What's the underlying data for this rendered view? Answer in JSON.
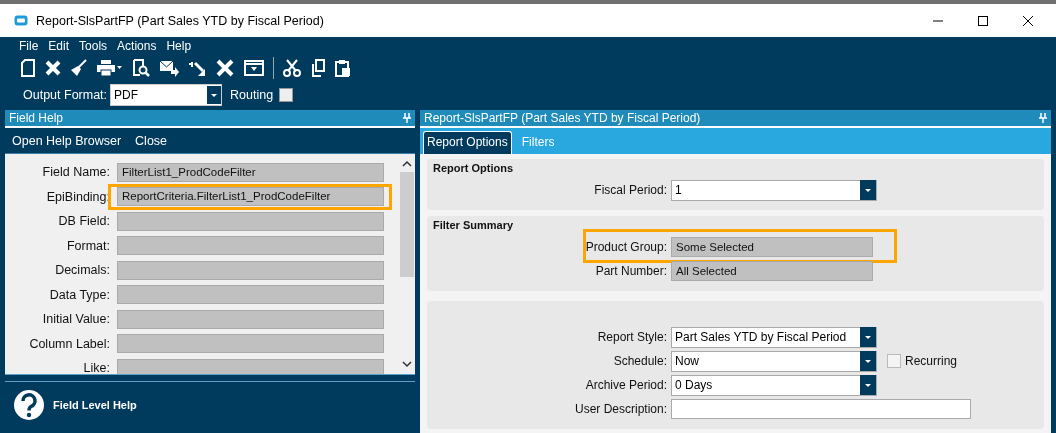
{
  "window": {
    "title": "Report-SlsPartFP (Part Sales YTD by Fiscal Period)"
  },
  "menu": [
    "File",
    "Edit",
    "Tools",
    "Actions",
    "Help"
  ],
  "output_format": {
    "label": "Output Format:",
    "value": "PDF"
  },
  "routing": {
    "label": "Routing",
    "checked": false
  },
  "field_help": {
    "title": "Field Help",
    "actions": [
      "Open Help Browser",
      "Close"
    ],
    "fields": [
      {
        "label": "Field Name:",
        "value": "FilterList1_ProdCodeFilter",
        "highlighted": false
      },
      {
        "label": "EpiBinding:",
        "value": "ReportCriteria.FilterList1_ProdCodeFilter",
        "highlighted": true
      },
      {
        "label": "DB Field:",
        "highlighted": false
      },
      {
        "label": "Format:",
        "highlighted": false
      },
      {
        "label": "Decimals:",
        "highlighted": false
      },
      {
        "label": "Data Type:",
        "highlighted": false
      },
      {
        "label": "Initial Value:",
        "highlighted": false
      },
      {
        "label": "Column Label:",
        "highlighted": false
      },
      {
        "label": "Like:",
        "highlighted": false
      }
    ],
    "footer": "Field Level Help"
  },
  "report": {
    "title": "Report-SlsPartFP (Part Sales YTD by Fiscal Period)",
    "tabs": [
      {
        "label": "Report Options",
        "selected": true
      },
      {
        "label": "Filters",
        "selected": false
      }
    ],
    "groups": [
      {
        "title": "Report Options",
        "rows": [
          {
            "kind": "dropdown",
            "label": "Fiscal Period:",
            "value": "1",
            "highlighted": false
          }
        ]
      },
      {
        "title": "Filter Summary",
        "rows": [
          {
            "kind": "readonly",
            "label": "Product Group:",
            "value": "Some Selected",
            "highlighted": true
          },
          {
            "kind": "readonly",
            "label": "Part Number:",
            "value": "All Selected",
            "highlighted": false
          }
        ]
      },
      {
        "rows": [
          {
            "kind": "dropdown",
            "label": "Report Style:",
            "value": "Part Sales YTD by Fiscal Period",
            "highlighted": false
          },
          {
            "kind": "dropdown",
            "label": "Schedule:",
            "value": "Now",
            "highlighted": false,
            "checkbox": {
              "label": "Recurring",
              "checked": false
            }
          },
          {
            "kind": "dropdown",
            "label": "Archive Period:",
            "value": "0 Days",
            "highlighted": false
          },
          {
            "kind": "text",
            "label": "User Description:",
            "highlighted": false
          }
        ]
      }
    ]
  }
}
